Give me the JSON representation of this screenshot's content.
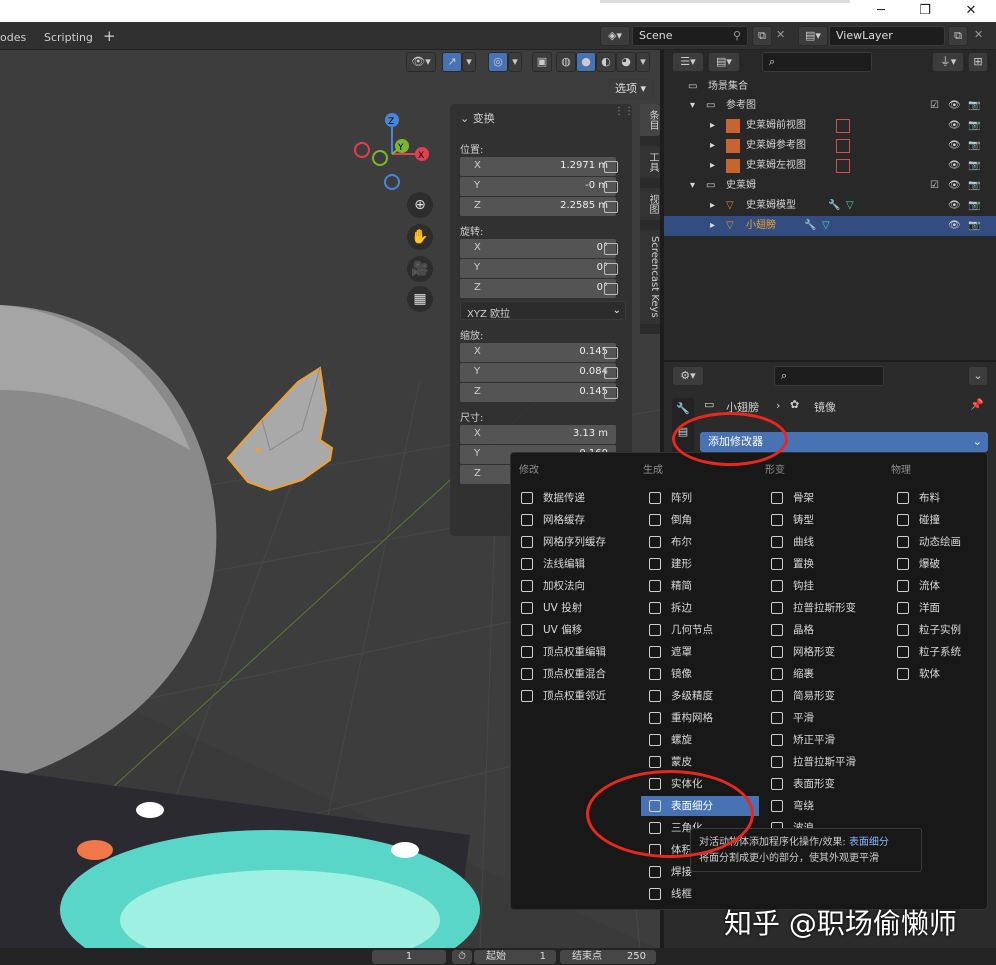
{
  "titlebar": {
    "minimize": "─",
    "maximize": "❐",
    "close": "✕"
  },
  "topbar": {
    "workspace_partial": "odes",
    "workspace_scripting": "Scripting",
    "add_workspace": "+",
    "scene_label": "Scene",
    "viewlayer_label": "ViewLayer"
  },
  "viewport_header": {
    "options_label": "选项"
  },
  "npanel": {
    "transform_title": "变换",
    "location_label": "位置:",
    "location": [
      {
        "axis": "X",
        "value": "1.2971 m"
      },
      {
        "axis": "Y",
        "value": "-0 m"
      },
      {
        "axis": "Z",
        "value": "2.2585 m"
      }
    ],
    "rotation_label": "旋转:",
    "rotation": [
      {
        "axis": "X",
        "value": "0°"
      },
      {
        "axis": "Y",
        "value": "0°"
      },
      {
        "axis": "Z",
        "value": "0°"
      }
    ],
    "rotation_mode": "XYZ 欧拉",
    "scale_label": "缩放:",
    "scale": [
      {
        "axis": "X",
        "value": "0.145"
      },
      {
        "axis": "Y",
        "value": "0.084"
      },
      {
        "axis": "Z",
        "value": "0.145"
      }
    ],
    "dimensions_label": "尺寸:",
    "dimensions": [
      {
        "axis": "X",
        "value": "3.13 m"
      },
      {
        "axis": "Y",
        "value": "0.160"
      },
      {
        "axis": "Z",
        "value": ""
      }
    ]
  },
  "sidetabs": [
    "条目",
    "工具",
    "视图",
    "Screencast Keys"
  ],
  "outliner": {
    "rows": [
      {
        "label": "场景集合",
        "indent": 0
      },
      {
        "label": "参考图",
        "indent": 1
      },
      {
        "label": "史莱姆前视图",
        "indent": 2
      },
      {
        "label": "史莱姆参考图",
        "indent": 2
      },
      {
        "label": "史莱姆左视图",
        "indent": 2
      },
      {
        "label": "史莱姆",
        "indent": 1
      },
      {
        "label": "史莱姆模型",
        "indent": 2
      },
      {
        "label": "小翅膀",
        "indent": 2
      }
    ]
  },
  "properties": {
    "object_name": "小翅膀",
    "modifier_name": "镜像",
    "add_modifier": "添加修改器"
  },
  "menu": {
    "columns": [
      {
        "title": "修改",
        "items": [
          "数据传递",
          "网格缓存",
          "网格序列缓存",
          "法线编辑",
          "加权法向",
          "UV 投射",
          "UV 偏移",
          "顶点权重编辑",
          "顶点权重混合",
          "顶点权重邻近"
        ]
      },
      {
        "title": "生成",
        "items": [
          "阵列",
          "倒角",
          "布尔",
          "建形",
          "精简",
          "拆边",
          "几何节点",
          "遮罩",
          "镜像",
          "多级精度",
          "重构网格",
          "螺旋",
          "蒙皮",
          "实体化",
          "表面细分",
          "三角化",
          "体积",
          "焊接",
          "线框"
        ]
      },
      {
        "title": "形变",
        "items": [
          "骨架",
          "铸型",
          "曲线",
          "置换",
          "钩挂",
          "拉普拉斯形变",
          "晶格",
          "网格形变",
          "缩裹",
          "简易形变",
          "平滑",
          "矫正平滑",
          "拉普拉斯平滑",
          "表面形变",
          "弯绕",
          "波浪"
        ]
      },
      {
        "title": "物理",
        "items": [
          "布料",
          "碰撞",
          "动态绘画",
          "爆破",
          "流体",
          "洋面",
          "粒子实例",
          "粒子系统",
          "软体"
        ]
      }
    ],
    "highlighted": "表面细分"
  },
  "tooltip": {
    "line1": "对活动物体添加程序化操作/效果:",
    "line1_name": "表面细分",
    "line2": "将面分割成更小的部分，使其外观更平滑"
  },
  "timeline": {
    "frame": "1",
    "start_label": "起始",
    "start": "1",
    "end_label": "结束点",
    "end": "250"
  },
  "watermark": "知乎 @职场偷懒师",
  "colors": {
    "accent": "#4772b3",
    "selection_orange": "#f0a030",
    "annotation_red": "#e8281e"
  }
}
